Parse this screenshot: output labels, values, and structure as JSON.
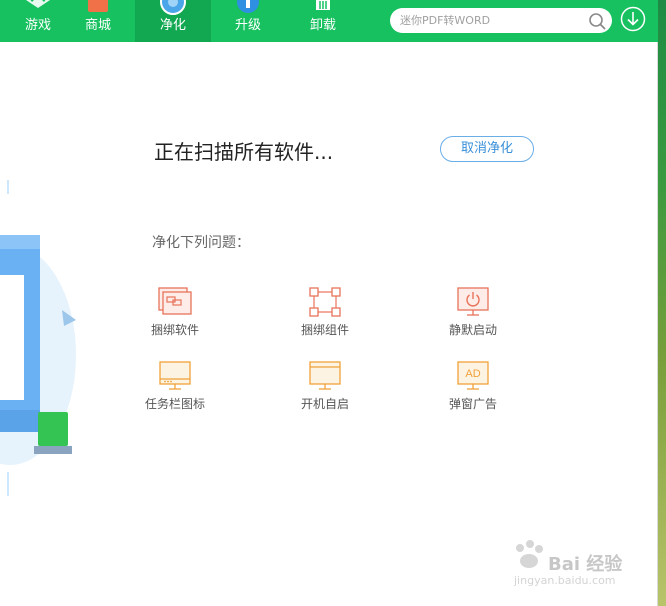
{
  "nav": {
    "items": [
      {
        "label": "游戏",
        "icon": "game-icon",
        "active": false
      },
      {
        "label": "商城",
        "icon": "store-icon",
        "active": false
      },
      {
        "label": "净化",
        "icon": "clean-icon",
        "active": true
      },
      {
        "label": "升级",
        "icon": "upgrade-icon",
        "active": false
      },
      {
        "label": "卸载",
        "icon": "uninstall-icon",
        "active": false
      }
    ],
    "search_placeholder": "迷你PDF转WORD",
    "search_icon": "search-icon",
    "download_icon": "download-icon"
  },
  "main": {
    "scan_title": "正在扫描所有软件...",
    "cancel_label": "取消净化",
    "issues_label": "净化下列问题：",
    "issues": [
      {
        "label": "捆绑软件",
        "icon": "bundled-software-icon",
        "color": "#e8735a"
      },
      {
        "label": "捆绑组件",
        "icon": "bundled-components-icon",
        "color": "#e8735a"
      },
      {
        "label": "静默启动",
        "icon": "silent-startup-icon",
        "color": "#e8735a"
      },
      {
        "label": "任务栏图标",
        "icon": "taskbar-icon",
        "color": "#f0a23a"
      },
      {
        "label": "开机自启",
        "icon": "autostart-icon",
        "color": "#f0a23a"
      },
      {
        "label": "弹窗广告",
        "icon": "popup-ad-icon",
        "color": "#f0a23a"
      }
    ]
  },
  "watermark": {
    "text": "Bai 经验",
    "sub": "jingyan.baidu.com"
  },
  "colors": {
    "nav_bg": "#17c15f",
    "nav_active": "#12a852",
    "accent_blue": "#3a8fd9",
    "issue_red": "#e8735a",
    "issue_orange": "#f0a23a"
  }
}
